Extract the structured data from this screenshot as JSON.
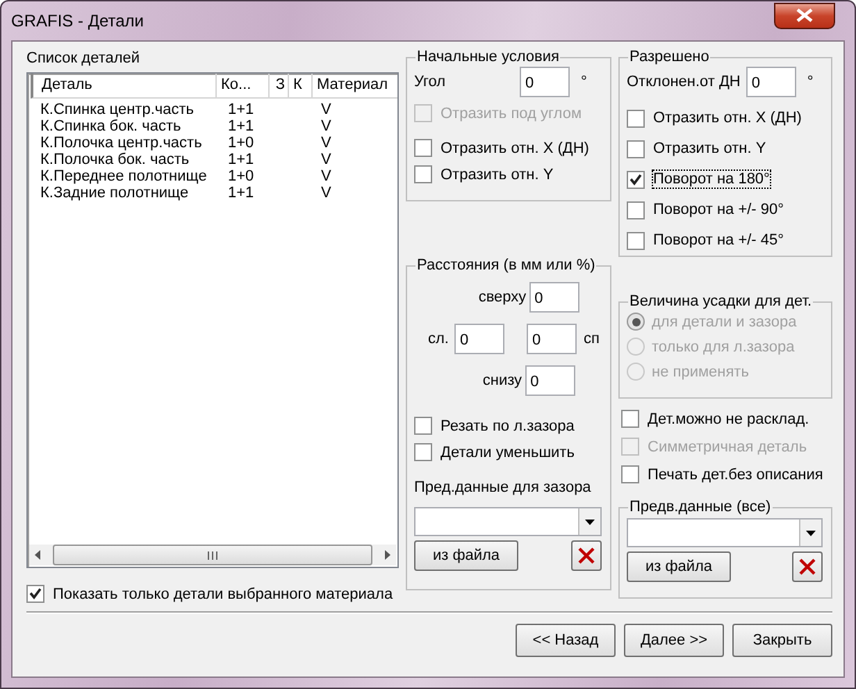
{
  "window": {
    "title": "GRAFIS - Детали"
  },
  "parts_list": {
    "label": "Список деталей",
    "columns": [
      "Деталь",
      "Ко...",
      "З",
      "К",
      "Материал"
    ],
    "rows": [
      {
        "cells": [
          "К.Спинка центр.часть",
          "1+1",
          "",
          "",
          "V"
        ]
      },
      {
        "cells": [
          "К.Спинка бок. часть",
          "1+1",
          "",
          "",
          "V"
        ]
      },
      {
        "cells": [
          "К.Полочка центр.часть",
          "1+0",
          "",
          "",
          "V"
        ]
      },
      {
        "cells": [
          "К.Полочка бок. часть",
          "1+1",
          "",
          "",
          "V"
        ]
      },
      {
        "cells": [
          "К.Переднее полотнище",
          "1+0",
          "",
          "",
          "V"
        ]
      },
      {
        "cells": [
          "К.Задние полотнище",
          "1+1",
          "",
          "",
          "V"
        ]
      }
    ],
    "filter_checkbox": {
      "label": "Показать только детали выбранного материала",
      "checked": true
    }
  },
  "initial_conditions": {
    "title": "Начальные условия",
    "angle_label": "Угол",
    "angle_value": "0",
    "unit": "°",
    "checkboxes": [
      {
        "label": "Отразить под углом",
        "checked": false,
        "disabled": true
      },
      {
        "label": "Отразить отн. X (ДН)",
        "checked": false,
        "disabled": false
      },
      {
        "label": "Отразить отн. Y",
        "checked": false,
        "disabled": false
      }
    ]
  },
  "allowed": {
    "title": "Разрешено",
    "deviation_label": "Отклонен.от ДН",
    "deviation_value": "0",
    "unit": "°",
    "checkboxes": [
      {
        "label": "Отразить отн. X (ДН)",
        "checked": false,
        "focused": false
      },
      {
        "label": "Отразить отн. Y",
        "checked": false,
        "focused": false
      },
      {
        "label": "Поворот на 180°",
        "checked": true,
        "focused": true
      },
      {
        "label": "Поворот на +/- 90°",
        "checked": false,
        "focused": false
      },
      {
        "label": "Поворот на +/- 45°",
        "checked": false,
        "focused": false
      }
    ]
  },
  "distances": {
    "title": "Расстояния (в мм или %)",
    "top_label": "сверху",
    "top_value": "0",
    "left_label": "сл.",
    "left_value": "0",
    "right_value": "0",
    "right_label": "сп",
    "bottom_label": "снизу",
    "bottom_value": "0",
    "checkboxes": [
      {
        "label": "Резать по л.зазора",
        "checked": false
      },
      {
        "label": "Детали уменьшить",
        "checked": false
      }
    ],
    "preset_label": "Пред.данные для зазора",
    "file_button": "из файла"
  },
  "shrinkage": {
    "title": "Величина усадки для дет.",
    "disabled": true,
    "options": [
      {
        "label": "для детали и зазора",
        "selected": true
      },
      {
        "label": "только для л.зазора",
        "selected": false
      },
      {
        "label": "не применять",
        "selected": false
      }
    ]
  },
  "extra_checkboxes": [
    {
      "label": "Дет.можно не расклад.",
      "checked": false,
      "disabled": false
    },
    {
      "label": "Симметричная деталь",
      "checked": false,
      "disabled": true
    },
    {
      "label": "Печать дет.без описания",
      "checked": false,
      "disabled": false
    }
  ],
  "preset_all": {
    "title": "Предв.данные (все)",
    "file_button": "из файла"
  },
  "buttons": [
    "<< Назад",
    "Далее >>",
    "Закрыть"
  ]
}
